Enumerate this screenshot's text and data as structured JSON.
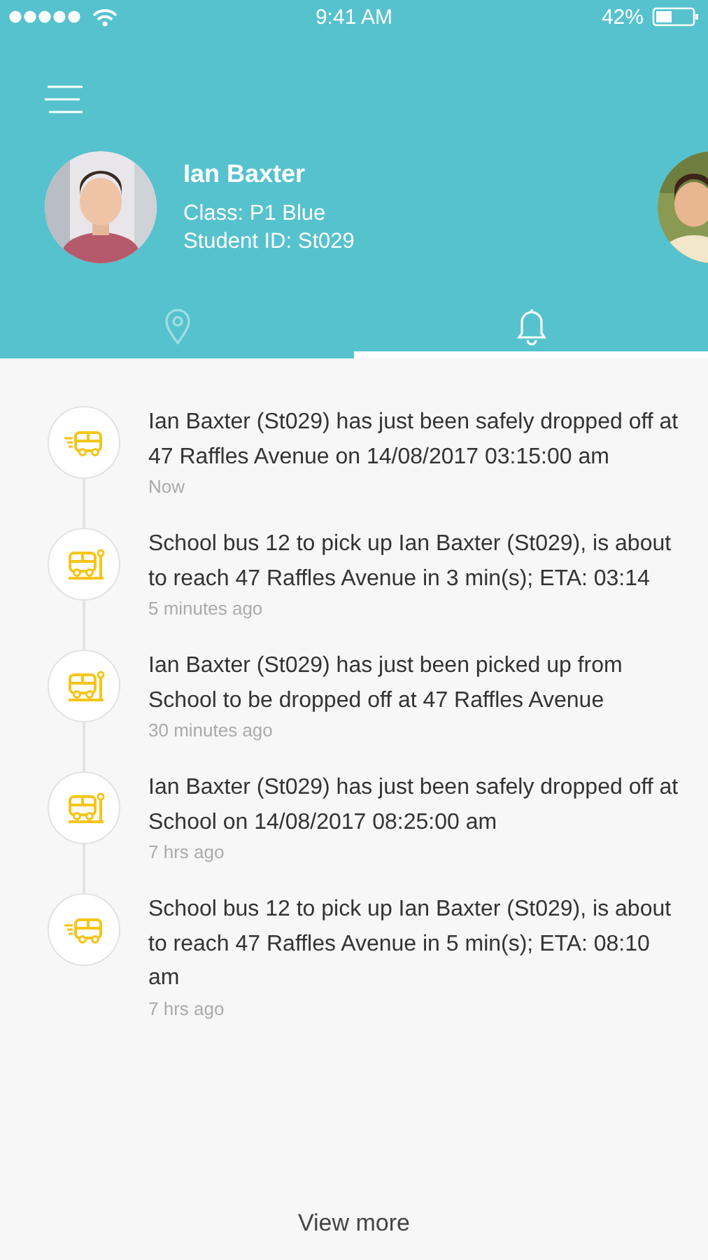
{
  "status_bar": {
    "time": "9:41 AM",
    "battery": "42%"
  },
  "profile": {
    "name": "Ian Baxter",
    "class": "Class: P1 Blue",
    "student_id": "Student ID: St029"
  },
  "tabs": [
    {
      "kind": "location",
      "selected": false
    },
    {
      "kind": "notifications",
      "selected": true
    }
  ],
  "notifications": [
    {
      "kind": "moving",
      "text": "Ian Baxter (St029) has just been safely dropped off at 47 Raffles Avenue on 14/08/2017 03:15:00 am",
      "time": "Now"
    },
    {
      "kind": "stop",
      "text": "School bus 12 to pick up Ian Baxter (St029), is about to reach 47 Raffles Avenue in 3 min(s); ETA: 03:14",
      "time": "5 minutes ago"
    },
    {
      "kind": "stop",
      "text": "Ian Baxter (St029) has just been picked up from School to be dropped off at 47 Raffles Avenue",
      "time": "30 minutes ago"
    },
    {
      "kind": "stop",
      "text": "Ian Baxter (St029) has just been safely dropped off at School on 14/08/2017 08:25:00 am",
      "time": "7 hrs ago"
    },
    {
      "kind": "moving",
      "text": "School bus 12 to pick up Ian Baxter (St029), is about to reach 47 Raffles Avenue in 5 min(s); ETA: 08:10 am",
      "time": "7 hrs ago"
    }
  ],
  "view_more": "View more"
}
